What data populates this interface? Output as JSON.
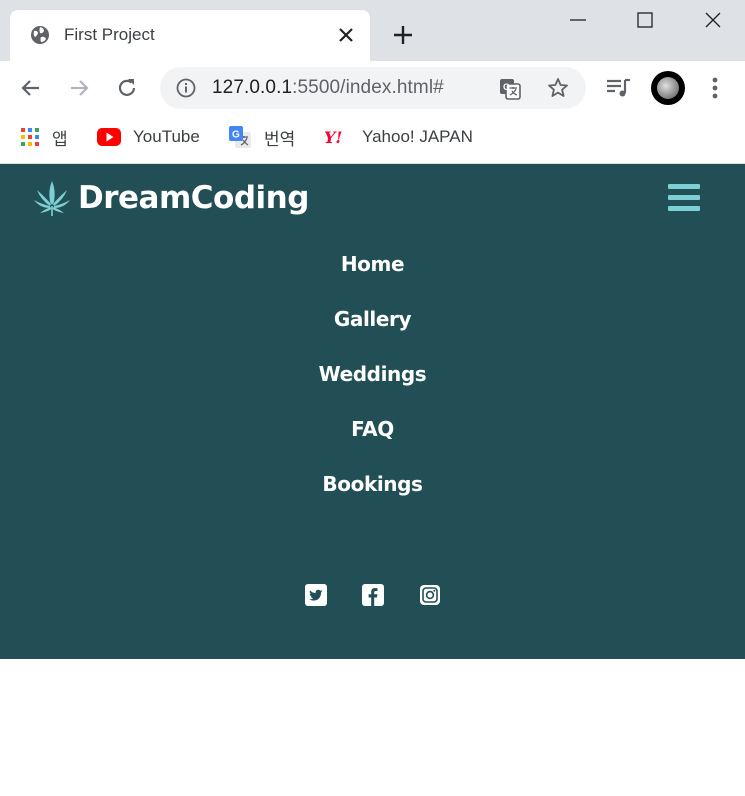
{
  "browser": {
    "tab": {
      "title": "First Project"
    },
    "address": {
      "url_host": "127.0.0.1",
      "url_rest": ":5500/index.html#"
    },
    "bookmarks": [
      {
        "label": "앱",
        "icon": "apps-grid-icon"
      },
      {
        "label": "YouTube",
        "icon": "youtube-icon"
      },
      {
        "label": "번역",
        "icon": "google-translate-icon"
      },
      {
        "label": "Yahoo! JAPAN",
        "icon": "yahoo-icon"
      }
    ]
  },
  "site": {
    "logo_text": "DreamCoding",
    "logo_icon": "leaf-icon",
    "menu": [
      {
        "label": "Home"
      },
      {
        "label": "Gallery"
      },
      {
        "label": "Weddings"
      },
      {
        "label": "FAQ"
      },
      {
        "label": "Bookings"
      }
    ],
    "socials": [
      {
        "icon": "twitter-icon"
      },
      {
        "icon": "facebook-icon"
      },
      {
        "icon": "instagram-icon"
      }
    ]
  },
  "colors": {
    "navbar_bg": "#224f55",
    "accent": "#7ccfd2",
    "menu_text": "#ffffff"
  }
}
